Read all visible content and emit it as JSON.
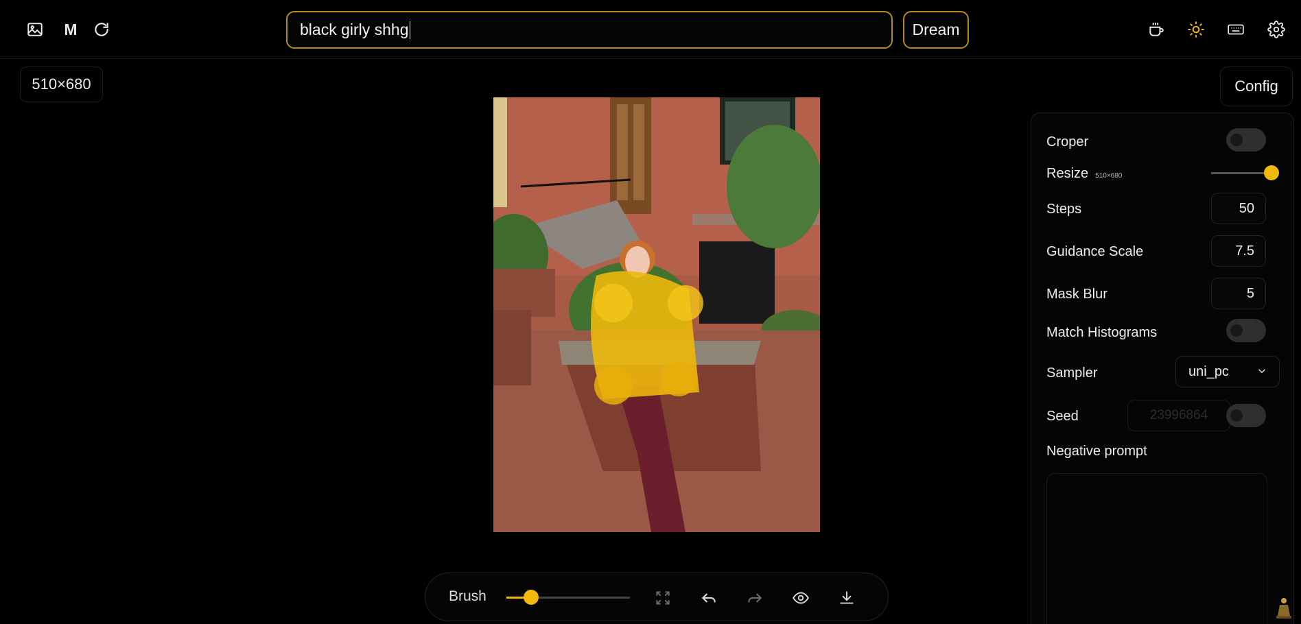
{
  "header": {
    "image_icon": "image-icon",
    "mask_letter": "M",
    "refresh_icon": "refresh-icon",
    "prompt_value": "black girly shhg",
    "dream_label": "Dream",
    "right_icons": [
      "coffee-cup-icon",
      "sun-icon",
      "keyboard-icon",
      "gear-icon"
    ],
    "accent_color": "#f0b90b"
  },
  "canvas": {
    "size_label": "510×680"
  },
  "config": {
    "button_label": "Config",
    "croper_label": "Croper",
    "resize_label": "Resize",
    "resize_note": "510×680",
    "steps_label": "Steps",
    "steps_value": "50",
    "guidance_label": "Guidance Scale",
    "guidance_value": "7.5",
    "mask_blur_label": "Mask Blur",
    "mask_blur_value": "5",
    "match_histograms_label": "Match Histograms",
    "sampler_label": "Sampler",
    "sampler_value": "uni_pc",
    "seed_label": "Seed",
    "seed_value": "23996864",
    "negative_prompt_label": "Negative prompt",
    "negative_prompt_value": ""
  },
  "toolbar": {
    "brush_label": "Brush",
    "icons": [
      "fullscreen-icon",
      "undo-icon",
      "redo-icon",
      "eye-icon",
      "download-icon"
    ]
  }
}
